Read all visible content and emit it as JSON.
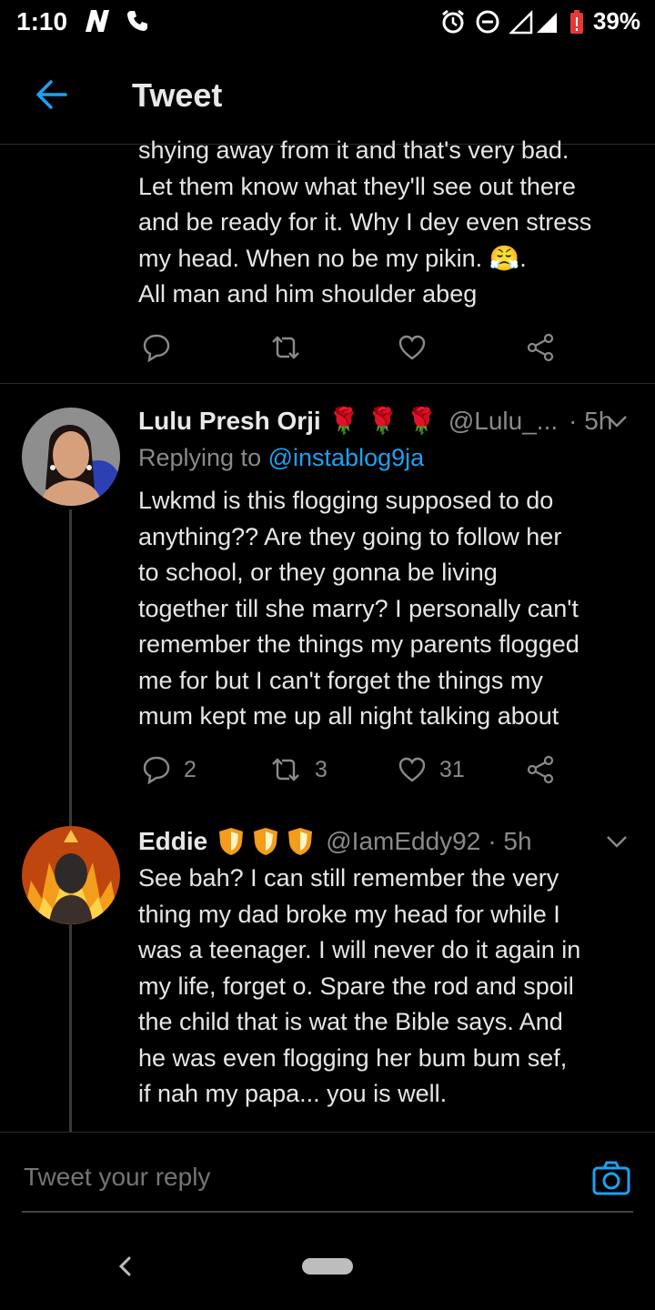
{
  "status_bar": {
    "time": "1:10",
    "battery": "39%",
    "network": "3G"
  },
  "app_bar": {
    "title": "Tweet"
  },
  "tweets": [
    {
      "partial": true,
      "body_lines": [
        "shying away from it and that's very bad.",
        "Let them know what they'll see out there",
        "and be ready for it. Why I dey even stress",
        "my head. When no be my pikin. 😤.",
        "All man and him shoulder abeg"
      ],
      "replies": "",
      "retweets": "",
      "likes": ""
    },
    {
      "name": "Lulu Presh Orji",
      "name_emojis": "🌹 🌹 🌹",
      "handle": "@Lulu_...",
      "time": "· 5h",
      "replying_prefix": "Replying to",
      "replying_to": "@instablog9ja",
      "body_lines": [
        "Lwkmd is this flogging supposed to do",
        "anything?? Are they going to follow her",
        "to school, or they gonna be living",
        "together till she marry? I personally can't",
        "remember the things my parents flogged",
        "me for but I can't forget the things my",
        "mum kept me up all night talking about"
      ],
      "replies": "2",
      "retweets": "3",
      "likes": "31"
    },
    {
      "name": "Eddie",
      "handle": "@IamEddy92",
      "time": "· 5h",
      "body_lines": [
        "See bah? I can still remember the very",
        "thing my dad broke my head for while I",
        "was a teenager. I will never do it again in",
        "my life, forget o. Spare the rod and spoil",
        "the child that is wat the Bible says. And",
        "he was even flogging her bum bum sef,",
        "if nah my papa... you is well."
      ]
    }
  ],
  "reply_box": {
    "placeholder": "Tweet your reply"
  },
  "colors": {
    "accent": "#1da1f2",
    "background": "#000000",
    "muted": "#8a8a8a"
  }
}
